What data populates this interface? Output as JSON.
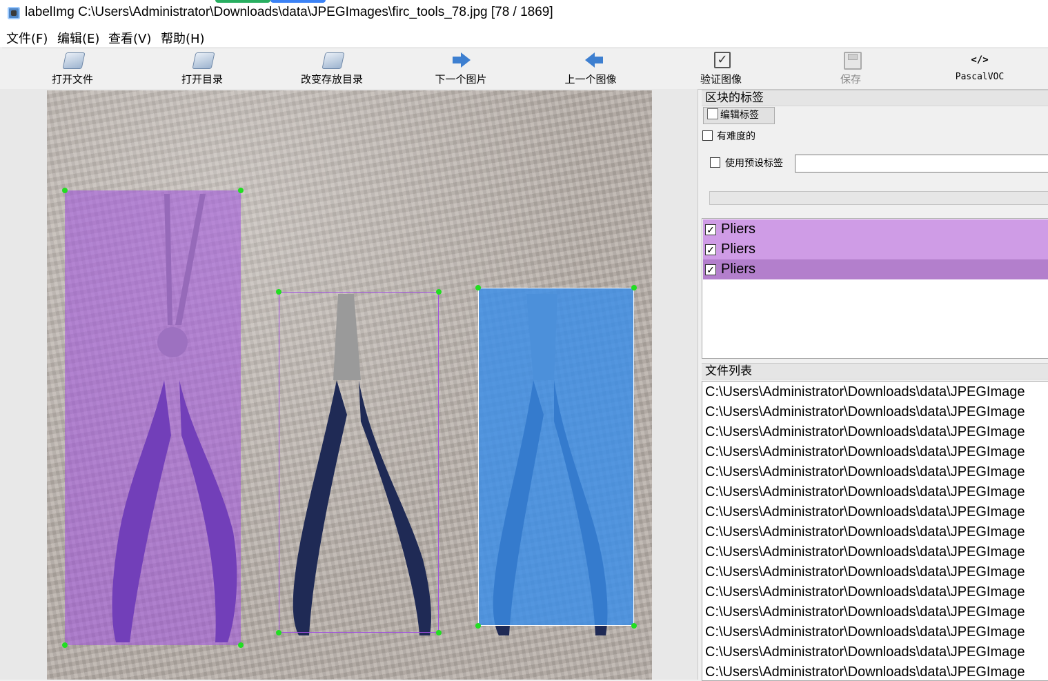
{
  "window": {
    "title": "labelImg C:\\Users\\Administrator\\Downloads\\data\\JPEGImages\\firc_tools_78.jpg [78 / 1869]"
  },
  "menu": [
    "文件(F)",
    "编辑(E)",
    "查看(V)",
    "帮助(H)"
  ],
  "toolbar": {
    "open_file": "打开文件",
    "open_dir": "打开目录",
    "change_save_dir": "改变存放目录",
    "next_image": "下一个图片",
    "prev_image": "上一个图像",
    "verify_image": "验证图像",
    "save": "保存",
    "format": "PascalVOC",
    "format_icon_text": "</>"
  },
  "canvas": {
    "image_name": "firc_tools_78.jpg",
    "boxes": [
      {
        "label": "Pliers",
        "color": "#a050e0",
        "state": "filled"
      },
      {
        "label": "Pliers",
        "color": "#a050e0",
        "state": "outline"
      },
      {
        "label": "Pliers",
        "color": "#3a8ee8",
        "state": "selected"
      }
    ]
  },
  "right_panel": {
    "box_labels_title": "区块的标签",
    "edit_label_button": "编辑标签",
    "difficult_label": "有难度的",
    "use_default_label": "使用预设标签",
    "default_label_value": "",
    "labels": [
      {
        "text": "Pliers",
        "checked": true,
        "bg": "#cf9ce6"
      },
      {
        "text": "Pliers",
        "checked": true,
        "bg": "#cf9ce6"
      },
      {
        "text": "Pliers",
        "checked": true,
        "bg": "#b37fcc"
      }
    ],
    "file_list_title": "文件列表",
    "files": [
      "C:\\Users\\Administrator\\Downloads\\data\\JPEGImage",
      "C:\\Users\\Administrator\\Downloads\\data\\JPEGImage",
      "C:\\Users\\Administrator\\Downloads\\data\\JPEGImage",
      "C:\\Users\\Administrator\\Downloads\\data\\JPEGImage",
      "C:\\Users\\Administrator\\Downloads\\data\\JPEGImage",
      "C:\\Users\\Administrator\\Downloads\\data\\JPEGImage",
      "C:\\Users\\Administrator\\Downloads\\data\\JPEGImage",
      "C:\\Users\\Administrator\\Downloads\\data\\JPEGImage",
      "C:\\Users\\Administrator\\Downloads\\data\\JPEGImage",
      "C:\\Users\\Administrator\\Downloads\\data\\JPEGImage",
      "C:\\Users\\Administrator\\Downloads\\data\\JPEGImage",
      "C:\\Users\\Administrator\\Downloads\\data\\JPEGImage",
      "C:\\Users\\Administrator\\Downloads\\data\\JPEGImage",
      "C:\\Users\\Administrator\\Downloads\\data\\JPEGImage",
      "C:\\Users\\Administrator\\Downloads\\data\\JPEGImage"
    ]
  },
  "colors": {
    "accent_purple": "#a050e0",
    "accent_blue": "#3a8ee8",
    "handle_green": "#22dd22"
  }
}
